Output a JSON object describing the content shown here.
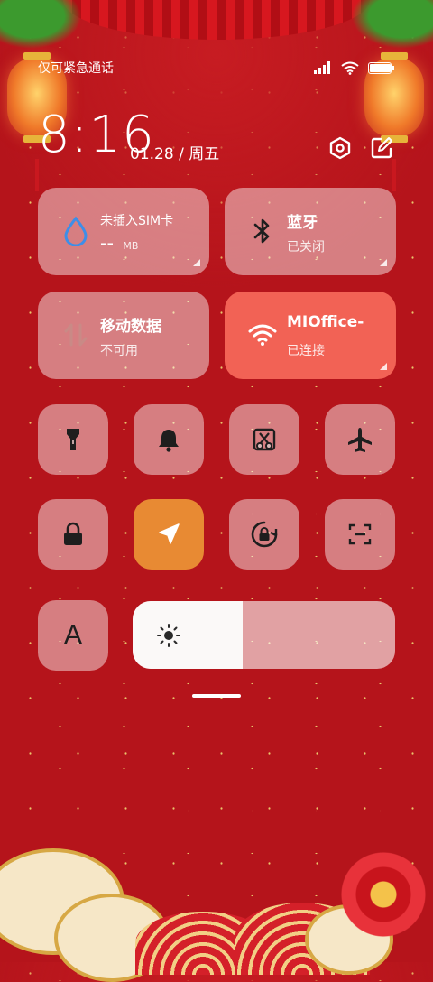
{
  "status_bar": {
    "carrier_text": "仅可紧急通话",
    "signal_icon": "signal-icon",
    "wifi_icon": "wifi-icon",
    "battery_level": 0.95
  },
  "header": {
    "time": "8:16",
    "date": "01.28",
    "separator": "/",
    "weekday": "周五",
    "settings_icon": "settings-icon",
    "edit_icon": "edit-icon"
  },
  "tiles": {
    "data_usage": {
      "title": "未插入SIM卡",
      "value": "--",
      "unit": "MB",
      "icon": "water-drop-icon"
    },
    "bluetooth": {
      "title": "蓝牙",
      "status": "已关闭",
      "icon": "bluetooth-icon"
    },
    "mobile_data": {
      "title": "移动数据",
      "status": "不可用",
      "icon": "data-arrows-icon"
    },
    "wifi": {
      "title": "MIOffice-",
      "status": "已连接",
      "icon": "wifi-icon"
    }
  },
  "toggles": [
    {
      "icon": "flashlight-icon",
      "on": false
    },
    {
      "icon": "bell-icon",
      "on": false
    },
    {
      "icon": "screenshot-icon",
      "on": false
    },
    {
      "icon": "airplane-icon",
      "on": false
    },
    {
      "icon": "lock-icon",
      "on": false
    },
    {
      "icon": "location-icon",
      "on": true
    },
    {
      "icon": "rotation-lock-icon",
      "on": false
    },
    {
      "icon": "scan-icon",
      "on": false
    }
  ],
  "auto_brightness": {
    "label": "A"
  },
  "brightness": {
    "level": 0.42,
    "icon": "sun-icon"
  },
  "colors": {
    "accent_active": "#f26255",
    "location_on": "#e88a33",
    "background": "#b5141b"
  }
}
